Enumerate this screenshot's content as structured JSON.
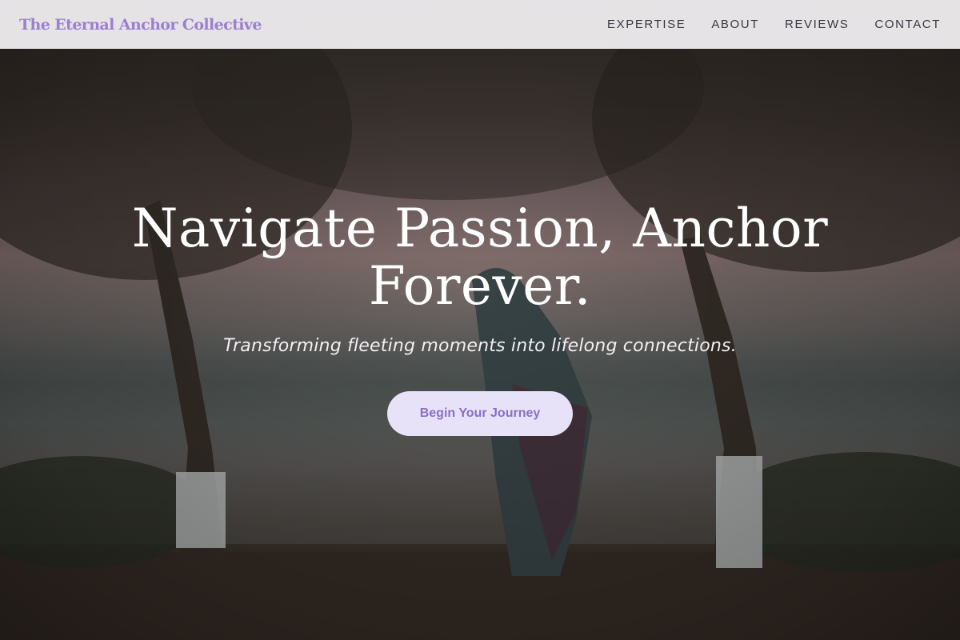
{
  "brand": {
    "name": "The Eternal Anchor Collective"
  },
  "nav": {
    "items": [
      {
        "label": "EXPERTISE"
      },
      {
        "label": "ABOUT"
      },
      {
        "label": "REVIEWS"
      },
      {
        "label": "CONTACT"
      }
    ]
  },
  "hero": {
    "title": "Navigate Passion, Anchor Forever.",
    "subtitle": "Transforming fleeting moments into lifelong connections.",
    "cta_label": "Begin Your Journey",
    "image_subject": "couple embracing under trees by a lake at dusk"
  },
  "colors": {
    "brand": "#9b7fd1",
    "navbar_bg": "#f4f2f4",
    "cta_bg": "#e8e2f9",
    "cta_text": "#8a6fc6",
    "hero_text": "#ffffff"
  }
}
